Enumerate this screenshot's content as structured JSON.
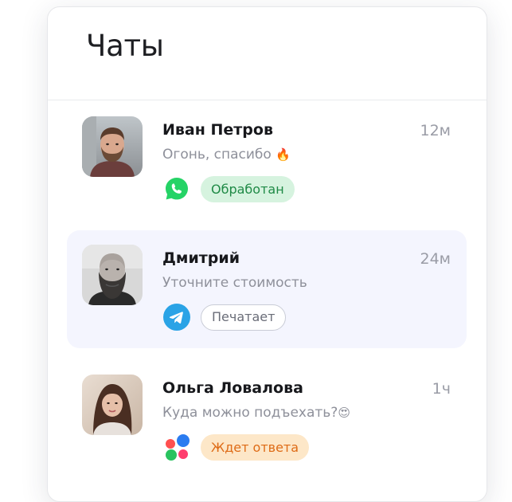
{
  "header": {
    "title": "Чаты"
  },
  "chats": [
    {
      "name": "Иван Петров",
      "time": "12м",
      "message": "Огонь, спасибо",
      "emoji": "🔥",
      "channel": "whatsapp-icon",
      "status": "Обработан",
      "status_color": "#1f8a46",
      "selected": false
    },
    {
      "name": "Дмитрий",
      "time": "24м",
      "message": "Уточните стоимость",
      "emoji": "",
      "channel": "telegram-icon",
      "status": "Печатает",
      "status_color": "#6a6d78",
      "selected": true
    },
    {
      "name": "Ольга Ловалова",
      "time": "1ч",
      "message": "Куда можно подъехать?",
      "emoji": "😍",
      "channel": "multi-dot-icon",
      "status": "Ждет ответа",
      "status_color": "#de6b16",
      "selected": false
    }
  ],
  "colors": {
    "accent_bg": "#f4f5fe",
    "whatsapp": "#25d366",
    "telegram": "#2aa3e6",
    "processed_bg": "#d6f3df",
    "waiting_bg": "#fde7c8"
  }
}
